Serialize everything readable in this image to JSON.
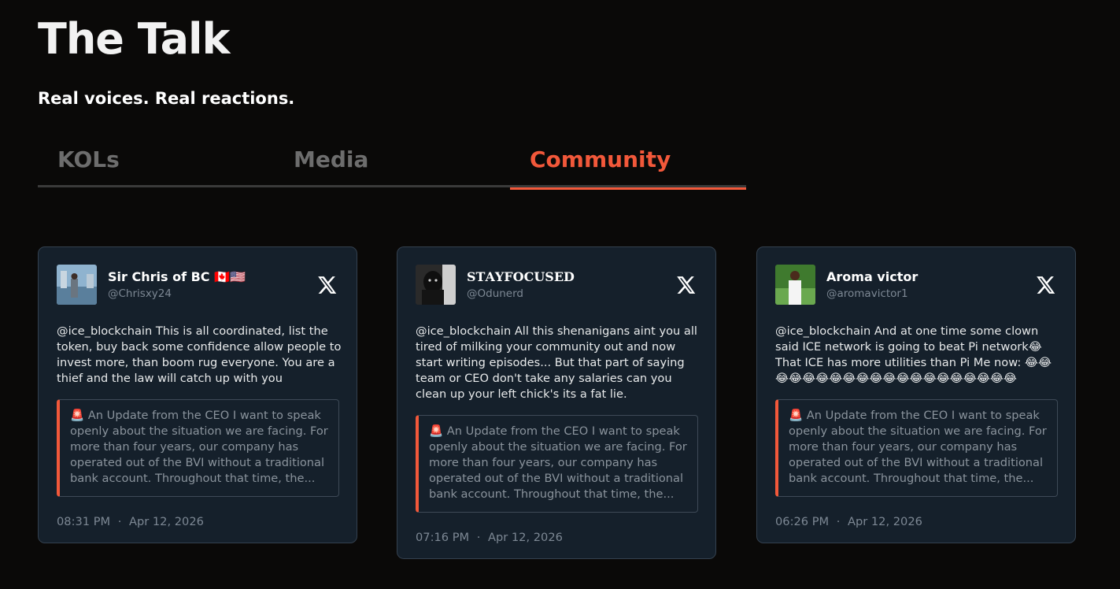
{
  "header": {
    "title": "The Talk",
    "subtitle": "Real voices. Real reactions."
  },
  "tabs": [
    {
      "label": "KOLs",
      "active": false
    },
    {
      "label": "Media",
      "active": false
    },
    {
      "label": "Community",
      "active": true
    }
  ],
  "colors": {
    "accent": "#f2583a",
    "card_bg": "#15202b",
    "page_bg": "#0a0908"
  },
  "cards": [
    {
      "display_name": "Sir Chris of BC 🇨🇦🇺🇸",
      "handle": "@Chrisxy24",
      "avatar_icon": "avatar-photo-icon",
      "platform_icon": "x-logo-icon",
      "text": "@ice_blockchain This is all coordinated, list the token, buy back some confidence allow people to invest more, than boom rug everyone. You are a thief and the law will catch up with you",
      "quote": "🚨 An Update from the CEO I want to speak openly about the situation we are facing. For more than four years, our company has operated out of the BVI without a traditional bank account. Throughout that time, the...",
      "time": "08:31 PM",
      "separator": "·",
      "date": "Apr 12, 2026"
    },
    {
      "display_name": "𝐒𝐓𝐀𝐘𝐅𝐎𝐂𝐔𝐒𝐄𝐃",
      "handle": "@Odunerd",
      "avatar_icon": "avatar-photo-icon",
      "platform_icon": "x-logo-icon",
      "text": "@ice_blockchain All this shenanigans aint you all tired of milking your community out and now start writing episodes... But that part of saying team or CEO don't take any salaries can you clean up your left chick's its a fat lie.",
      "quote": "🚨 An Update from the CEO I want to speak openly about the situation we are facing. For more than four years, our company has operated out of the BVI without a traditional bank account. Throughout that time, the...",
      "time": "07:16 PM",
      "separator": "·",
      "date": "Apr 12, 2026"
    },
    {
      "display_name": "Aroma victor",
      "handle": "@aromavictor1",
      "avatar_icon": "avatar-photo-icon",
      "platform_icon": "x-logo-icon",
      "text": "@ice_blockchain And at one time some clown said ICE network is going to beat Pi network😂 That ICE has more utilities than Pi Me now: 😂😂😂😂😂😂😂😂😂😂😂😂😂😂😂😂😂😂😂😂",
      "quote": "🚨 An Update from the CEO I want to speak openly about the situation we are facing. For more than four years, our company has operated out of the BVI without a traditional bank account. Throughout that time, the...",
      "time": "06:26 PM",
      "separator": "·",
      "date": "Apr 12, 2026"
    }
  ]
}
